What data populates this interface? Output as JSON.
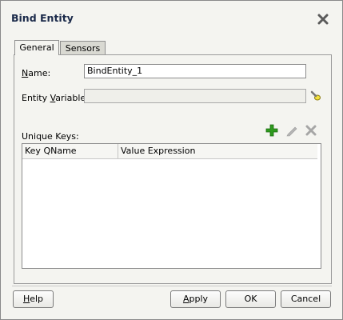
{
  "dialog": {
    "title": "Bind Entity",
    "close_icon": "close-icon"
  },
  "tabs": [
    {
      "label": "General",
      "selected": true
    },
    {
      "label": "Sensors",
      "selected": false
    }
  ],
  "form": {
    "name_label_prefix": "N",
    "name_label_rest": "ame:",
    "name_value": "BindEntity_1",
    "entity_var_label_prefix": "Entity ",
    "entity_var_label_u": "V",
    "entity_var_label_rest": "ariable:",
    "entity_var_value": "",
    "entity_var_browse_icon": "flashlight-icon"
  },
  "unique_keys": {
    "label": "Unique Keys:",
    "add_icon": "add-icon",
    "edit_icon": "edit-icon",
    "delete_icon": "delete-icon",
    "columns": [
      "Key QName",
      "Value Expression"
    ],
    "rows": []
  },
  "buttons": {
    "help_u": "H",
    "help_rest": "elp",
    "apply_u": "A",
    "apply_rest": "pply",
    "ok": "OK",
    "cancel": "Cancel"
  },
  "colors": {
    "add": "#2e9a1e",
    "title": "#1b2a4a"
  }
}
